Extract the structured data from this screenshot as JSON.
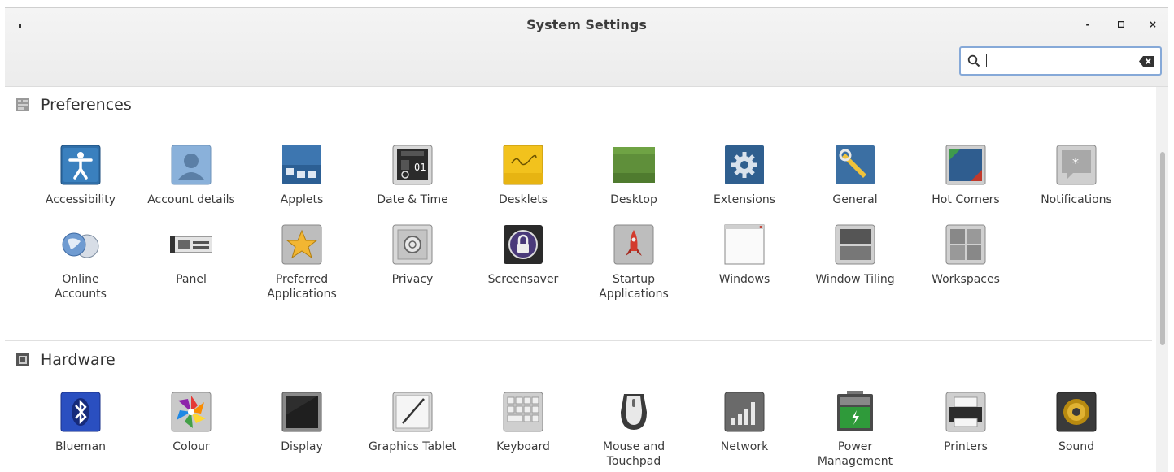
{
  "window": {
    "title": "System Settings",
    "minimize": "-",
    "maximize": "▫",
    "close": "×"
  },
  "search": {
    "value": "",
    "placeholder": ""
  },
  "sections": {
    "preferences": {
      "title": "Preferences",
      "items": [
        {
          "label": "Accessibility",
          "icon": "accessibility-icon"
        },
        {
          "label": "Account details",
          "icon": "account-icon"
        },
        {
          "label": "Applets",
          "icon": "applets-icon"
        },
        {
          "label": "Date & Time",
          "icon": "calendar-icon"
        },
        {
          "label": "Desklets",
          "icon": "note-icon"
        },
        {
          "label": "Desktop",
          "icon": "desktop-icon"
        },
        {
          "label": "Extensions",
          "icon": "gear-icon"
        },
        {
          "label": "General",
          "icon": "wrench-icon"
        },
        {
          "label": "Hot Corners",
          "icon": "hot-corners-icon"
        },
        {
          "label": "Notifications",
          "icon": "notification-icon"
        },
        {
          "label": "Online\nAccounts",
          "icon": "globe-icon"
        },
        {
          "label": "Panel",
          "icon": "panel-icon"
        },
        {
          "label": "Preferred\nApplications",
          "icon": "star-icon"
        },
        {
          "label": "Privacy",
          "icon": "safe-icon"
        },
        {
          "label": "Screensaver",
          "icon": "lock-icon"
        },
        {
          "label": "Startup\nApplications",
          "icon": "rocket-icon"
        },
        {
          "label": "Windows",
          "icon": "window-icon"
        },
        {
          "label": "Window Tiling",
          "icon": "tiling-icon"
        },
        {
          "label": "Workspaces",
          "icon": "workspaces-icon"
        }
      ]
    },
    "hardware": {
      "title": "Hardware",
      "items": [
        {
          "label": "Blueman",
          "icon": "bluetooth-icon"
        },
        {
          "label": "Colour",
          "icon": "colour-icon"
        },
        {
          "label": "Display",
          "icon": "display-icon"
        },
        {
          "label": "Graphics Tablet",
          "icon": "tablet-icon"
        },
        {
          "label": "Keyboard",
          "icon": "keyboard-icon"
        },
        {
          "label": "Mouse and\nTouchpad",
          "icon": "mouse-icon"
        },
        {
          "label": "Network",
          "icon": "network-icon"
        },
        {
          "label": "Power\nManagement",
          "icon": "battery-icon"
        },
        {
          "label": "Printers",
          "icon": "printer-icon"
        },
        {
          "label": "Sound",
          "icon": "speaker-icon"
        }
      ]
    }
  }
}
